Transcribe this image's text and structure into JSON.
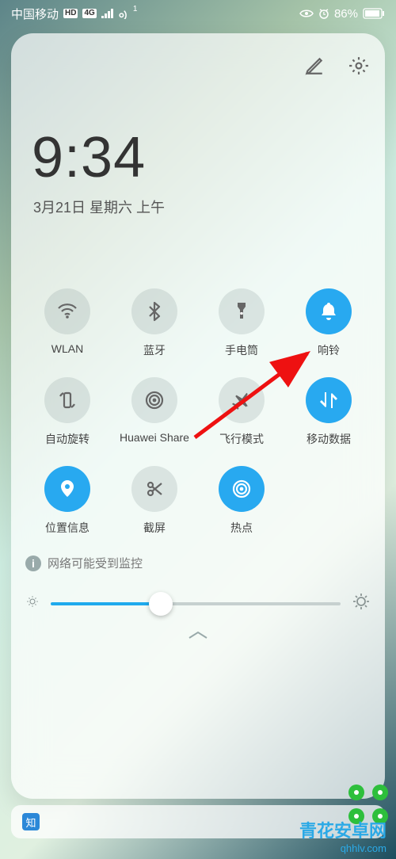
{
  "status": {
    "carrier": "中国移动",
    "hd": "HD",
    "net": "4G",
    "sim_super": "1",
    "battery_pct": "86%"
  },
  "header": {
    "time": "9:34",
    "date": "3月21日 星期六 上午"
  },
  "toggles": [
    {
      "id": "wlan",
      "label": "WLAN",
      "on": false,
      "icon": "wifi-icon"
    },
    {
      "id": "bluetooth",
      "label": "蓝牙",
      "on": false,
      "icon": "bluetooth-icon"
    },
    {
      "id": "flashlight",
      "label": "手电筒",
      "on": false,
      "icon": "flashlight-icon"
    },
    {
      "id": "sound",
      "label": "响铃",
      "on": true,
      "icon": "bell-icon"
    },
    {
      "id": "autorotate",
      "label": "自动旋转",
      "on": false,
      "icon": "rotate-icon"
    },
    {
      "id": "huaweishare",
      "label": "Huawei Share",
      "on": false,
      "icon": "share-icon"
    },
    {
      "id": "airplane",
      "label": "飞行模式",
      "on": false,
      "icon": "airplane-icon"
    },
    {
      "id": "mobiledata",
      "label": "移动数据",
      "on": true,
      "icon": "data-icon"
    },
    {
      "id": "location",
      "label": "位置信息",
      "on": true,
      "icon": "location-icon"
    },
    {
      "id": "screenshot",
      "label": "截屏",
      "on": false,
      "icon": "scissors-icon"
    },
    {
      "id": "hotspot",
      "label": "热点",
      "on": true,
      "icon": "hotspot-icon"
    }
  ],
  "info_text": "网络可能受到监控",
  "brightness": {
    "percent": 38
  },
  "notification": {
    "app_glyph": "知"
  },
  "watermark": {
    "line1": "青花安卓网",
    "line2": "qhhlv.com"
  }
}
